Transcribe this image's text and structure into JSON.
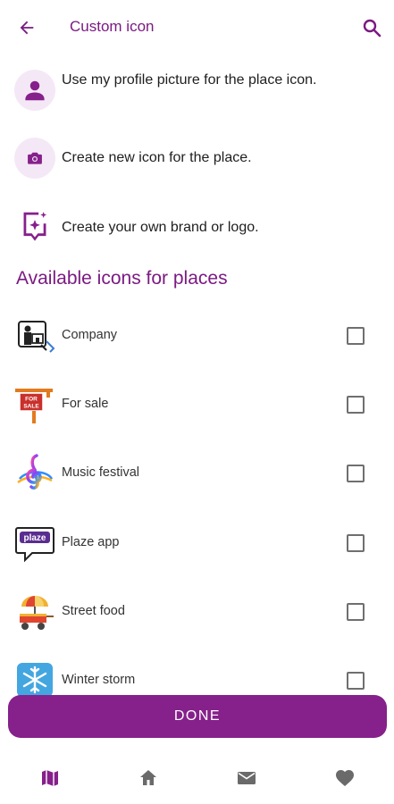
{
  "header": {
    "title": "Custom icon",
    "back_icon": "arrow-left-icon",
    "search_icon": "search-icon"
  },
  "options": [
    {
      "label": "Use my profile picture for the place icon.",
      "icon": "person-icon"
    },
    {
      "label": "Create new icon for the place.",
      "icon": "camera-icon"
    },
    {
      "label": "Create your own brand or logo.",
      "icon": "sparkle-frame-icon"
    }
  ],
  "section_title": "Available icons for places",
  "places": [
    {
      "label": "Company",
      "icon": "company-icon",
      "checked": false
    },
    {
      "label": "For sale",
      "icon": "for-sale-sign-icon",
      "sign_text": "FOR SALE",
      "checked": false
    },
    {
      "label": "Music festival",
      "icon": "treble-clef-icon",
      "checked": false
    },
    {
      "label": "Plaze app",
      "icon": "plaze-bubble-icon",
      "checked": false
    },
    {
      "label": "Street food",
      "icon": "food-cart-icon",
      "checked": false
    },
    {
      "label": "Winter storm",
      "icon": "snowflake-icon",
      "checked": false
    }
  ],
  "done_label": "DONE",
  "nav": [
    {
      "name": "map",
      "icon": "map-icon",
      "active": true
    },
    {
      "name": "home",
      "icon": "home-icon",
      "active": false
    },
    {
      "name": "mail",
      "icon": "mail-icon",
      "active": false
    },
    {
      "name": "favorites",
      "icon": "heart-icon",
      "active": false
    }
  ],
  "colors": {
    "accent": "#86208b",
    "title": "#7b1a82",
    "icon_bg": "#f4e8f7",
    "nav_inactive": "#6a6a6a"
  }
}
